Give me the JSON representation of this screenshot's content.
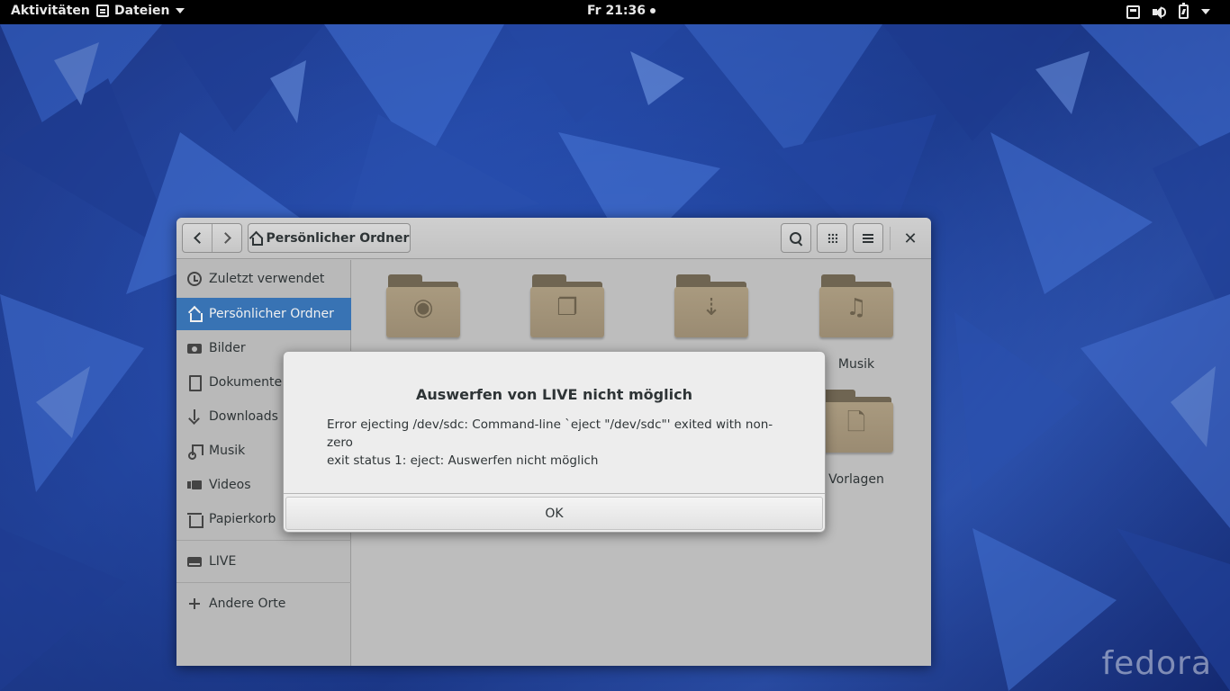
{
  "topbar": {
    "activities": "Aktivitäten",
    "app_menu": "Dateien",
    "clock": "Fr 21:36"
  },
  "window": {
    "path_button": "Persönlicher Ordner"
  },
  "sidebar": {
    "items": [
      {
        "label": "Zuletzt verwendet",
        "icon": "clock-icon"
      },
      {
        "label": "Persönlicher Ordner",
        "icon": "home-icon",
        "active": true
      },
      {
        "label": "Bilder",
        "icon": "camera-icon"
      },
      {
        "label": "Dokumente",
        "icon": "document-icon"
      },
      {
        "label": "Downloads",
        "icon": "download-icon"
      },
      {
        "label": "Musik",
        "icon": "music-icon"
      },
      {
        "label": "Videos",
        "icon": "video-icon"
      },
      {
        "label": "Papierkorb",
        "icon": "trash-icon"
      }
    ],
    "devices": [
      {
        "label": "LIVE",
        "icon": "drive-icon"
      }
    ],
    "other": {
      "label": "Andere Orte",
      "icon": "plus-icon"
    }
  },
  "content": {
    "folders": [
      {
        "label": "",
        "icon": "pictures-folder-icon"
      },
      {
        "label": "",
        "icon": "documents-folder-icon"
      },
      {
        "label": "",
        "icon": "downloads-folder-icon"
      },
      {
        "label": "Musik",
        "icon": "music-folder-icon"
      },
      {
        "label": "Vorlagen",
        "icon": "templates-folder-icon"
      }
    ]
  },
  "dialog": {
    "title": "Auswerfen von LIVE nicht möglich",
    "message_line1": "Error ejecting /dev/sdc: Command-line `eject \"/dev/sdc\"' exited with non-zero",
    "message_line2": "exit status 1: eject: Auswerfen nicht möglich",
    "ok_label": "OK"
  },
  "branding": {
    "logo_text": "fedora"
  },
  "colors": {
    "accent": "#3873b4",
    "desktop": "#2a4fb0",
    "topbar": "#000000"
  }
}
